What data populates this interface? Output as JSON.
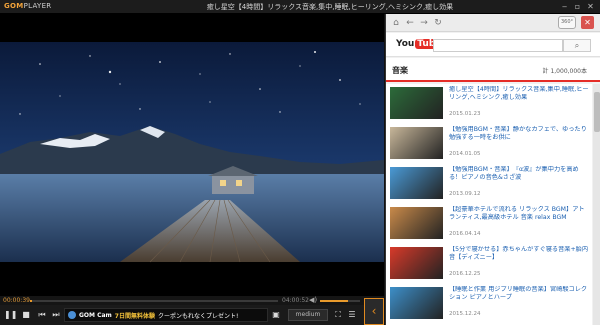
{
  "app": {
    "logo_main": "GOM",
    "logo_sub": "PLAYER",
    "title": "癒し星空【4時間】リラックス音楽,集中,睡眠,ヒーリング,ヘミシンク,癒し効果",
    "window_buttons": [
      "minimize-icon",
      "restore-icon",
      "close-icon"
    ]
  },
  "player": {
    "elapsed": "00:00:39",
    "duration": "04:00:52",
    "progress_fraction": 0.003,
    "volume_fraction": 0.7,
    "quality": "medium",
    "ad": {
      "brand": "GOM Cam",
      "accent": "7日間無料体験",
      "tail": "クーポンもれなくプレゼント!"
    },
    "controls": [
      "pause-icon",
      "stop-icon",
      "prev-icon",
      "next-icon",
      "volume-icon",
      "capture-icon",
      "fullscreen-icon",
      "playlist-icon",
      "panel-toggle-icon"
    ]
  },
  "browser": {
    "nav": [
      "home-icon",
      "back-icon",
      "forward-icon",
      "refresh-icon"
    ],
    "badge_360": "360°",
    "youtube": {
      "you": "You",
      "tube": "Tube",
      "search_placeholder": "",
      "search_icon": "search-icon"
    },
    "section": {
      "title": "音楽",
      "count": "計 1,000,000本"
    },
    "items": [
      {
        "title": "癒し星空【4時間】リラックス音楽,集中,睡眠,ヒーリング,ヘミシンク,癒し効果",
        "date": "2015.01.23",
        "thumb_color": "#2c6b3a"
      },
      {
        "title": "【勉強用BGM・音楽】静かなカフェで、ゆったり勉強する一時をお供に",
        "date": "2014.01.05",
        "thumb_color": "#c8b79a"
      },
      {
        "title": "【勉強用BGM・音楽】　『α波』が集中力を高める！ピアノの音色&さざ波",
        "date": "2013.09.12",
        "thumb_color": "#4a9ad6"
      },
      {
        "title": "【超豪華ホテルで流れる リラックス BGM】アトランティス,最高級ホテル 音楽 relax BGM",
        "date": "2016.04.14",
        "thumb_color": "#c98a4a"
      },
      {
        "title": "【5分で寝かせる】赤ちゃんがすぐ寝る音楽+胎内音【ディズニー】",
        "date": "2016.12.25",
        "thumb_color": "#d83a2a"
      },
      {
        "title": "【睡眠と作業 用ジブリ睡眠の音楽】宮崎駿コレクション ピアノとハープ",
        "date": "2015.12.24",
        "thumb_color": "#3d8fc9"
      }
    ]
  }
}
